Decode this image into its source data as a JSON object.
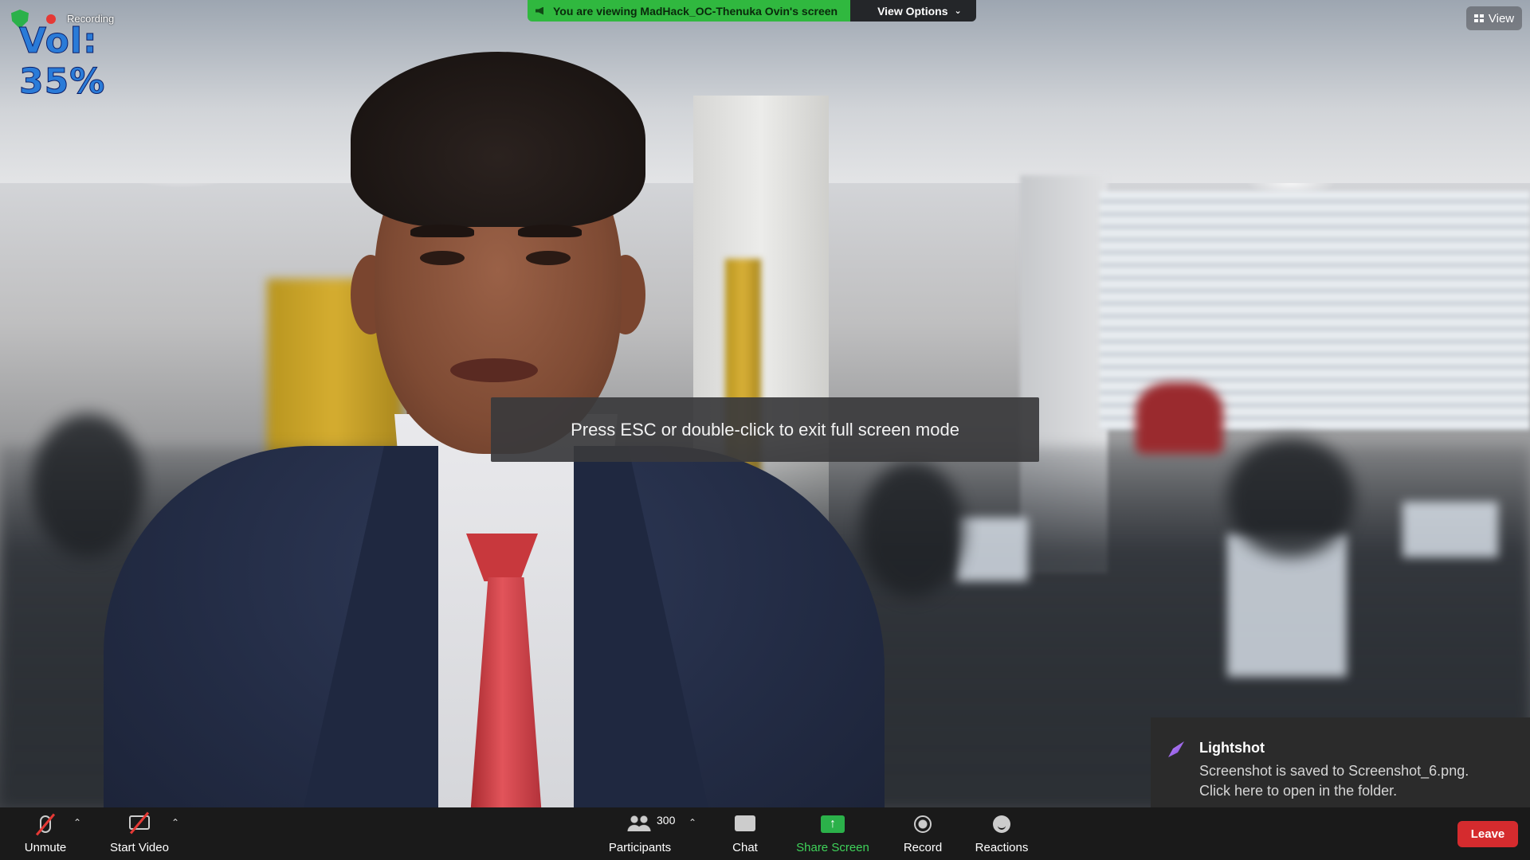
{
  "recording": {
    "label": "Recording"
  },
  "volume_overlay": "Vol: 35%",
  "share_banner": {
    "text": "You are viewing MadHack_OC-Thenuka Ovin's screen",
    "view_options": "View Options"
  },
  "view_button": "View",
  "fullscreen_hint": "Press ESC or double-click to exit full screen mode",
  "notification": {
    "app": "Lightshot",
    "line1": "Screenshot is saved to Screenshot_6.png.",
    "line2": "Click here to open in the folder."
  },
  "toolbar": {
    "unmute": "Unmute",
    "start_video": "Start Video",
    "participants": "Participants",
    "participants_count": "300",
    "chat": "Chat",
    "share_screen": "Share Screen",
    "record": "Record",
    "reactions": "Reactions",
    "leave": "Leave"
  },
  "colors": {
    "share_green": "#30b83f",
    "leave_red": "#d52b2e",
    "toolbar_bg": "#1a1a1a"
  }
}
